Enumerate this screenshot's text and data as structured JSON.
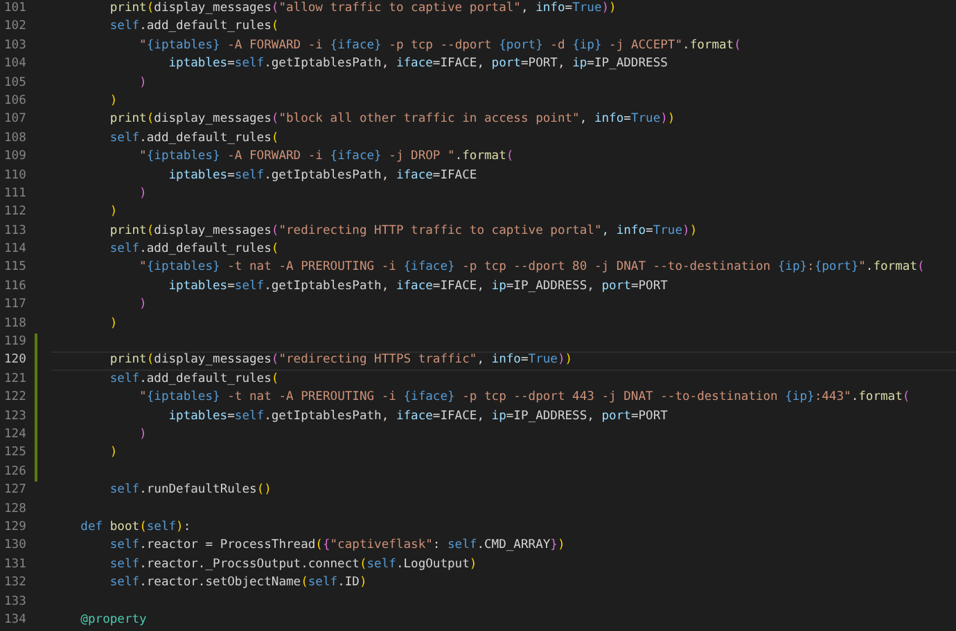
{
  "editor": {
    "lines": [
      {
        "number": "101",
        "modified": false,
        "current": false,
        "tokens": [
          {
            "kind": "fn",
            "text": "        print"
          },
          {
            "kind": "br1",
            "text": "("
          },
          {
            "kind": "plain",
            "text": "display_messages"
          },
          {
            "kind": "br2",
            "text": "("
          },
          {
            "kind": "str",
            "text": "\"allow traffic to captive portal\""
          },
          {
            "kind": "plain",
            "text": ", "
          },
          {
            "kind": "var",
            "text": "info"
          },
          {
            "kind": "plain",
            "text": "="
          },
          {
            "kind": "const",
            "text": "True"
          },
          {
            "kind": "br2",
            "text": ")"
          },
          {
            "kind": "br1",
            "text": ")"
          }
        ]
      },
      {
        "number": "102",
        "modified": false,
        "current": false,
        "tokens": [
          {
            "kind": "key",
            "text": "        self"
          },
          {
            "kind": "plain",
            "text": ".add_default_rules"
          },
          {
            "kind": "br1",
            "text": "("
          }
        ]
      },
      {
        "number": "103",
        "modified": false,
        "current": false,
        "tokens": [
          {
            "kind": "str",
            "text": "            \""
          },
          {
            "kind": "interp",
            "text": "{iptables}"
          },
          {
            "kind": "str",
            "text": " -A FORWARD -i "
          },
          {
            "kind": "interp",
            "text": "{iface}"
          },
          {
            "kind": "str",
            "text": " -p tcp --dport "
          },
          {
            "kind": "interp",
            "text": "{port}"
          },
          {
            "kind": "str",
            "text": " -d "
          },
          {
            "kind": "interp",
            "text": "{ip}"
          },
          {
            "kind": "str",
            "text": " -j ACCEPT\""
          },
          {
            "kind": "plain",
            "text": "."
          },
          {
            "kind": "fn",
            "text": "format"
          },
          {
            "kind": "br2",
            "text": "("
          }
        ]
      },
      {
        "number": "104",
        "modified": false,
        "current": false,
        "tokens": [
          {
            "kind": "var",
            "text": "                iptables"
          },
          {
            "kind": "plain",
            "text": "="
          },
          {
            "kind": "key",
            "text": "self"
          },
          {
            "kind": "plain",
            "text": ".getIptablesPath, "
          },
          {
            "kind": "var",
            "text": "iface"
          },
          {
            "kind": "plain",
            "text": "=IFACE, "
          },
          {
            "kind": "var",
            "text": "port"
          },
          {
            "kind": "plain",
            "text": "=PORT, "
          },
          {
            "kind": "var",
            "text": "ip"
          },
          {
            "kind": "plain",
            "text": "=IP_ADDRESS"
          }
        ]
      },
      {
        "number": "105",
        "modified": false,
        "current": false,
        "tokens": [
          {
            "kind": "br2",
            "text": "            )"
          }
        ]
      },
      {
        "number": "106",
        "modified": false,
        "current": false,
        "tokens": [
          {
            "kind": "br1",
            "text": "        )"
          }
        ]
      },
      {
        "number": "107",
        "modified": false,
        "current": false,
        "tokens": [
          {
            "kind": "fn",
            "text": "        print"
          },
          {
            "kind": "br1",
            "text": "("
          },
          {
            "kind": "plain",
            "text": "display_messages"
          },
          {
            "kind": "br2",
            "text": "("
          },
          {
            "kind": "str",
            "text": "\"block all other traffic in access point\""
          },
          {
            "kind": "plain",
            "text": ", "
          },
          {
            "kind": "var",
            "text": "info"
          },
          {
            "kind": "plain",
            "text": "="
          },
          {
            "kind": "const",
            "text": "True"
          },
          {
            "kind": "br2",
            "text": ")"
          },
          {
            "kind": "br1",
            "text": ")"
          }
        ]
      },
      {
        "number": "108",
        "modified": false,
        "current": false,
        "tokens": [
          {
            "kind": "key",
            "text": "        self"
          },
          {
            "kind": "plain",
            "text": ".add_default_rules"
          },
          {
            "kind": "br1",
            "text": "("
          }
        ]
      },
      {
        "number": "109",
        "modified": false,
        "current": false,
        "tokens": [
          {
            "kind": "str",
            "text": "            \""
          },
          {
            "kind": "interp",
            "text": "{iptables}"
          },
          {
            "kind": "str",
            "text": " -A FORWARD -i "
          },
          {
            "kind": "interp",
            "text": "{iface}"
          },
          {
            "kind": "str",
            "text": " -j DROP \""
          },
          {
            "kind": "plain",
            "text": "."
          },
          {
            "kind": "fn",
            "text": "format"
          },
          {
            "kind": "br2",
            "text": "("
          }
        ]
      },
      {
        "number": "110",
        "modified": false,
        "current": false,
        "tokens": [
          {
            "kind": "var",
            "text": "                iptables"
          },
          {
            "kind": "plain",
            "text": "="
          },
          {
            "kind": "key",
            "text": "self"
          },
          {
            "kind": "plain",
            "text": ".getIptablesPath, "
          },
          {
            "kind": "var",
            "text": "iface"
          },
          {
            "kind": "plain",
            "text": "=IFACE"
          }
        ]
      },
      {
        "number": "111",
        "modified": false,
        "current": false,
        "tokens": [
          {
            "kind": "br2",
            "text": "            )"
          }
        ]
      },
      {
        "number": "112",
        "modified": false,
        "current": false,
        "tokens": [
          {
            "kind": "br1",
            "text": "        )"
          }
        ]
      },
      {
        "number": "113",
        "modified": false,
        "current": false,
        "tokens": [
          {
            "kind": "fn",
            "text": "        print"
          },
          {
            "kind": "br1",
            "text": "("
          },
          {
            "kind": "plain",
            "text": "display_messages"
          },
          {
            "kind": "br2",
            "text": "("
          },
          {
            "kind": "str",
            "text": "\"redirecting HTTP traffic to captive portal\""
          },
          {
            "kind": "plain",
            "text": ", "
          },
          {
            "kind": "var",
            "text": "info"
          },
          {
            "kind": "plain",
            "text": "="
          },
          {
            "kind": "const",
            "text": "True"
          },
          {
            "kind": "br2",
            "text": ")"
          },
          {
            "kind": "br1",
            "text": ")"
          }
        ]
      },
      {
        "number": "114",
        "modified": false,
        "current": false,
        "tokens": [
          {
            "kind": "key",
            "text": "        self"
          },
          {
            "kind": "plain",
            "text": ".add_default_rules"
          },
          {
            "kind": "br1",
            "text": "("
          }
        ]
      },
      {
        "number": "115",
        "modified": false,
        "current": false,
        "tokens": [
          {
            "kind": "str",
            "text": "            \""
          },
          {
            "kind": "interp",
            "text": "{iptables}"
          },
          {
            "kind": "str",
            "text": " -t nat -A PREROUTING -i "
          },
          {
            "kind": "interp",
            "text": "{iface}"
          },
          {
            "kind": "str",
            "text": " -p tcp --dport 80 -j DNAT --to-destination "
          },
          {
            "kind": "interp",
            "text": "{ip}"
          },
          {
            "kind": "str",
            "text": ":"
          },
          {
            "kind": "interp",
            "text": "{port}"
          },
          {
            "kind": "str",
            "text": "\""
          },
          {
            "kind": "plain",
            "text": "."
          },
          {
            "kind": "fn",
            "text": "format"
          },
          {
            "kind": "br2",
            "text": "("
          }
        ]
      },
      {
        "number": "116",
        "modified": false,
        "current": false,
        "tokens": [
          {
            "kind": "var",
            "text": "                iptables"
          },
          {
            "kind": "plain",
            "text": "="
          },
          {
            "kind": "key",
            "text": "self"
          },
          {
            "kind": "plain",
            "text": ".getIptablesPath, "
          },
          {
            "kind": "var",
            "text": "iface"
          },
          {
            "kind": "plain",
            "text": "=IFACE, "
          },
          {
            "kind": "var",
            "text": "ip"
          },
          {
            "kind": "plain",
            "text": "=IP_ADDRESS, "
          },
          {
            "kind": "var",
            "text": "port"
          },
          {
            "kind": "plain",
            "text": "=PORT"
          }
        ]
      },
      {
        "number": "117",
        "modified": false,
        "current": false,
        "tokens": [
          {
            "kind": "br2",
            "text": "            )"
          }
        ]
      },
      {
        "number": "118",
        "modified": false,
        "current": false,
        "tokens": [
          {
            "kind": "br1",
            "text": "        )"
          }
        ]
      },
      {
        "number": "119",
        "modified": true,
        "current": false
      },
      {
        "number": "120",
        "modified": true,
        "current": true,
        "tokens": [
          {
            "kind": "fn",
            "text": "        print"
          },
          {
            "kind": "br1",
            "text": "("
          },
          {
            "kind": "plain",
            "text": "display_messages"
          },
          {
            "kind": "br2",
            "text": "("
          },
          {
            "kind": "str",
            "text": "\"redirecting HTTPS traffic\""
          },
          {
            "kind": "plain",
            "text": ", "
          },
          {
            "kind": "var",
            "text": "info"
          },
          {
            "kind": "plain",
            "text": "="
          },
          {
            "kind": "const",
            "text": "True"
          },
          {
            "kind": "br2",
            "text": ")"
          },
          {
            "kind": "br1",
            "text": ")"
          }
        ]
      },
      {
        "number": "121",
        "modified": true,
        "current": false,
        "tokens": [
          {
            "kind": "key",
            "text": "        self"
          },
          {
            "kind": "plain",
            "text": ".add_default_rules"
          },
          {
            "kind": "br1",
            "text": "("
          }
        ]
      },
      {
        "number": "122",
        "modified": true,
        "current": false,
        "tokens": [
          {
            "kind": "str",
            "text": "            \""
          },
          {
            "kind": "interp",
            "text": "{iptables}"
          },
          {
            "kind": "str",
            "text": " -t nat -A PREROUTING -i "
          },
          {
            "kind": "interp",
            "text": "{iface}"
          },
          {
            "kind": "str",
            "text": " -p tcp --dport 443 -j DNAT --to-destination "
          },
          {
            "kind": "interp",
            "text": "{ip}"
          },
          {
            "kind": "str",
            "text": ":443\""
          },
          {
            "kind": "plain",
            "text": "."
          },
          {
            "kind": "fn",
            "text": "format"
          },
          {
            "kind": "br2",
            "text": "("
          }
        ]
      },
      {
        "number": "123",
        "modified": true,
        "current": false,
        "tokens": [
          {
            "kind": "var",
            "text": "                iptables"
          },
          {
            "kind": "plain",
            "text": "="
          },
          {
            "kind": "key",
            "text": "self"
          },
          {
            "kind": "plain",
            "text": ".getIptablesPath, "
          },
          {
            "kind": "var",
            "text": "iface"
          },
          {
            "kind": "plain",
            "text": "=IFACE, "
          },
          {
            "kind": "var",
            "text": "ip"
          },
          {
            "kind": "plain",
            "text": "=IP_ADDRESS, "
          },
          {
            "kind": "var",
            "text": "port"
          },
          {
            "kind": "plain",
            "text": "=PORT"
          }
        ]
      },
      {
        "number": "124",
        "modified": true,
        "current": false,
        "tokens": [
          {
            "kind": "br2",
            "text": "            )"
          }
        ]
      },
      {
        "number": "125",
        "modified": true,
        "current": false,
        "tokens": [
          {
            "kind": "br1",
            "text": "        )"
          }
        ]
      },
      {
        "number": "126",
        "modified": true,
        "current": false
      },
      {
        "number": "127",
        "modified": false,
        "current": false,
        "tokens": [
          {
            "kind": "key",
            "text": "        self"
          },
          {
            "kind": "plain",
            "text": ".runDefaultRules"
          },
          {
            "kind": "br1",
            "text": "()"
          }
        ]
      },
      {
        "number": "128",
        "modified": false,
        "current": false
      },
      {
        "number": "129",
        "modified": false,
        "current": false,
        "tokens": [
          {
            "kind": "key",
            "text": "    def"
          },
          {
            "kind": "fn",
            "text": " boot"
          },
          {
            "kind": "br1",
            "text": "("
          },
          {
            "kind": "key",
            "text": "self"
          },
          {
            "kind": "br1",
            "text": ")"
          },
          {
            "kind": "plain",
            "text": ":"
          }
        ]
      },
      {
        "number": "130",
        "modified": false,
        "current": false,
        "tokens": [
          {
            "kind": "key",
            "text": "        self"
          },
          {
            "kind": "plain",
            "text": ".reactor = ProcessThread"
          },
          {
            "kind": "br1",
            "text": "("
          },
          {
            "kind": "br2",
            "text": "{"
          },
          {
            "kind": "str",
            "text": "\"captiveflask\""
          },
          {
            "kind": "plain",
            "text": ": "
          },
          {
            "kind": "key",
            "text": "self"
          },
          {
            "kind": "plain",
            "text": ".CMD_ARRAY"
          },
          {
            "kind": "br2",
            "text": "}"
          },
          {
            "kind": "br1",
            "text": ")"
          }
        ]
      },
      {
        "number": "131",
        "modified": false,
        "current": false,
        "tokens": [
          {
            "kind": "key",
            "text": "        self"
          },
          {
            "kind": "plain",
            "text": ".reactor._ProcssOutput.connect"
          },
          {
            "kind": "br1",
            "text": "("
          },
          {
            "kind": "key",
            "text": "self"
          },
          {
            "kind": "plain",
            "text": ".LogOutput"
          },
          {
            "kind": "br1",
            "text": ")"
          }
        ]
      },
      {
        "number": "132",
        "modified": false,
        "current": false,
        "tokens": [
          {
            "kind": "key",
            "text": "        self"
          },
          {
            "kind": "plain",
            "text": ".reactor.setObjectName"
          },
          {
            "kind": "br1",
            "text": "("
          },
          {
            "kind": "key",
            "text": "self"
          },
          {
            "kind": "plain",
            "text": ".ID"
          },
          {
            "kind": "br1",
            "text": ")"
          }
        ]
      },
      {
        "number": "133",
        "modified": false,
        "current": false
      },
      {
        "number": "134",
        "modified": false,
        "current": false,
        "tokens": [
          {
            "kind": "deco",
            "text": "    @property"
          }
        ]
      }
    ]
  }
}
